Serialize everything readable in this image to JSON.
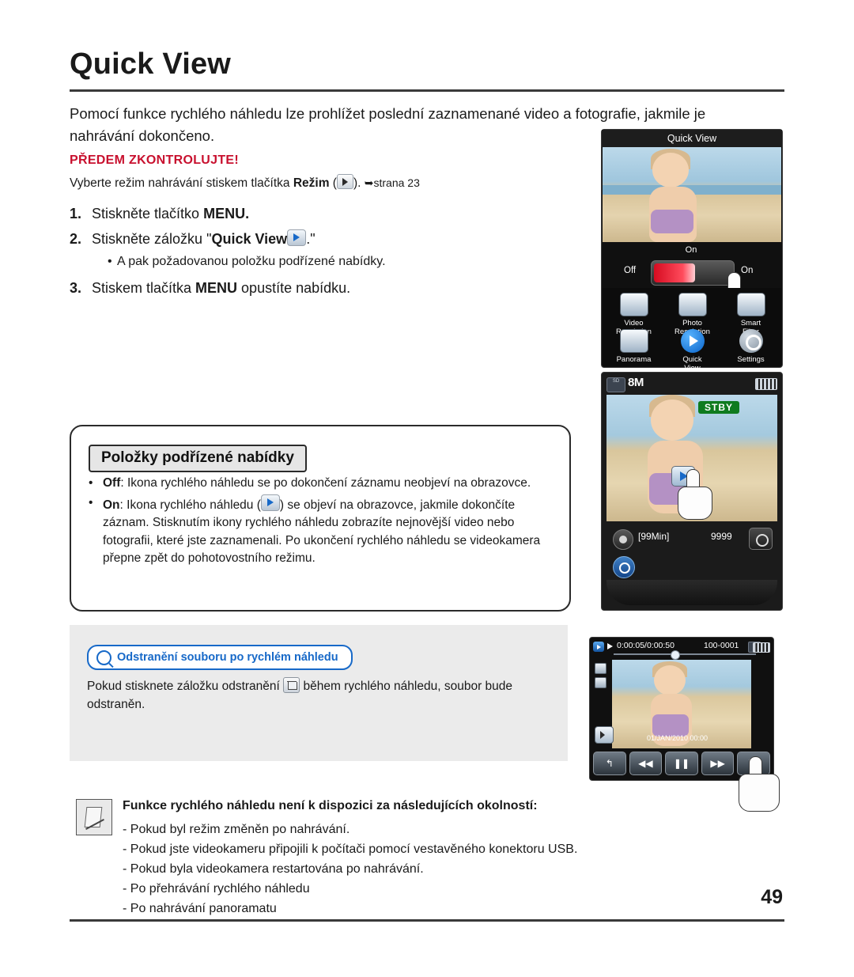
{
  "page": {
    "title": "Quick View",
    "number": "49"
  },
  "intro": "Pomocí funkce rychlého náhledu lze prohlížet poslední zaznamenané video a fotografie, jakmile je nahrávání dokončeno.",
  "precheck": {
    "label": "PŘEDEM ZKONTROLUJTE!",
    "text_before": "Vyberte režim nahrávání stiskem tlačítka ",
    "text_bold": "Režim",
    "text_paren_open": " (",
    "text_paren_close": "). ",
    "reference": "strana 23"
  },
  "steps": [
    {
      "num": "1.",
      "text_before": "Stiskněte tlačítko ",
      "bold": "MENU.",
      "text_after": ""
    },
    {
      "num": "2.",
      "text_before": "Stiskněte záložku \"",
      "bold": "Quick View",
      "text_after": ".\""
    },
    {
      "num": "3.",
      "text_before": "Stiskem tlačítka ",
      "bold": "MENU",
      "text_after": " opustíte nabídku."
    }
  ],
  "substep": "A pak požadovanou položku podřízené nabídky.",
  "submenu": {
    "title": "Položky podřízené nabídky",
    "items": [
      {
        "name": "Off",
        "text": ": Ikona rychlého náhledu se po dokončení záznamu neobjeví na obrazovce."
      },
      {
        "name": "On",
        "text_a": ": Ikona rychlého náhledu (",
        "text_b": ") se objeví na obrazovce, jakmile dokončíte záznam. Stisknutím ikony rychlého náhledu zobrazíte nejnovější video nebo fotografii, které jste zaznamenali. Po ukončení rychlého náhledu se videokamera přepne zpět do pohotovostního režimu."
      }
    ]
  },
  "tip": {
    "pill_label": "Odstranění souboru po rychlém náhledu",
    "text_before": "Pokud stisknete záložku odstranění ",
    "text_after": " během rychlého náhledu, soubor bude odstraněn."
  },
  "note": {
    "heading": "Funkce rychlého náhledu není k dispozici za následujících okolností:",
    "lines": [
      "- Pokud byl režim změněn po nahrávání.",
      "- Pokud jste videokameru připojili k počítači pomocí vestavěného konektoru USB.",
      "- Pokud byla videokamera restartována po nahrávání.",
      "- Po přehrávání rychlého náhledu",
      "- Po nahrávání panoramatu"
    ]
  },
  "screen_menu": {
    "title": "Quick View",
    "toggle_on_top": "On",
    "toggle_off": "Off",
    "toggle_on": "On",
    "grid": [
      {
        "label_line1": "Video",
        "label_line2": "Resolution",
        "icon": "video-resolution-icon"
      },
      {
        "label_line1": "Photo",
        "label_line2": "Resolution",
        "icon": "photo-resolution-icon"
      },
      {
        "label_line1": "Smart",
        "label_line2": "Filter",
        "icon": "smart-filter-icon"
      },
      {
        "label_line1": "Panorama",
        "label_line2": "",
        "icon": "panorama-icon"
      },
      {
        "label_line1": "Quick",
        "label_line2": "View",
        "icon": "quick-view-icon"
      },
      {
        "label_line1": "Settings",
        "label_line2": "",
        "icon": "settings-gear-icon"
      }
    ]
  },
  "screen_standby": {
    "badge": "SD",
    "resolution": "8M",
    "status": "STBY",
    "remaining_time": "[99Min]",
    "remaining_shots": "9999"
  },
  "screen_playback": {
    "time": "0:00:05/0:00:50",
    "file": "100-0001",
    "date": "01/JAN/2010 00:00",
    "controls": [
      "back-icon",
      "rewind-icon",
      "pause-icon",
      "forward-icon",
      "delete-icon"
    ]
  }
}
